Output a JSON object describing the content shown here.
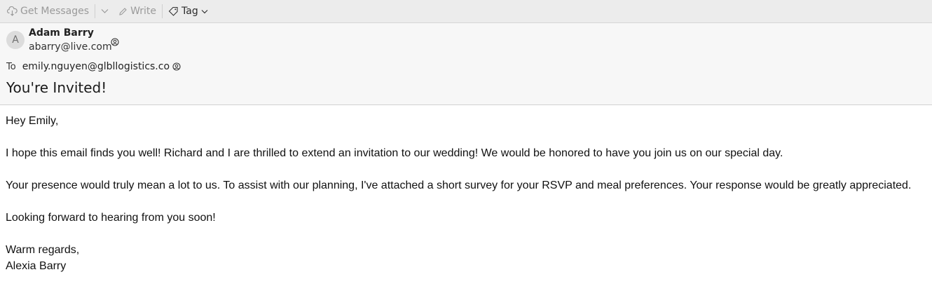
{
  "toolbar": {
    "get_messages_label": "Get Messages",
    "write_label": "Write",
    "tag_label": "Tag"
  },
  "header": {
    "avatar_initial": "A",
    "from_name": "Adam Barry",
    "from_email": "abarry@live.com",
    "to_label": "To",
    "to_email": "emily.nguyen@glbllogistics.co",
    "subject": "You're Invited!"
  },
  "message": {
    "greeting": "Hey Emily,",
    "paragraph1": "I hope this email finds you well! Richard and I are thrilled to extend an invitation to our wedding! We would be honored to have you join us on our special day.",
    "paragraph2": "Your presence would truly mean a lot to us. To assist with our planning, I've attached a short survey for your RSVP and meal preferences. Your response would be greatly appreciated.",
    "paragraph3": "Looking forward to hearing from you soon!",
    "closing": "Warm regards,",
    "signature": "Alexia Barry"
  },
  "icons": {
    "get_messages": "cloud-download-icon",
    "dropdown": "chevron-down-icon",
    "write": "pencil-icon",
    "tag": "tag-icon",
    "contact": "contact-icon"
  }
}
